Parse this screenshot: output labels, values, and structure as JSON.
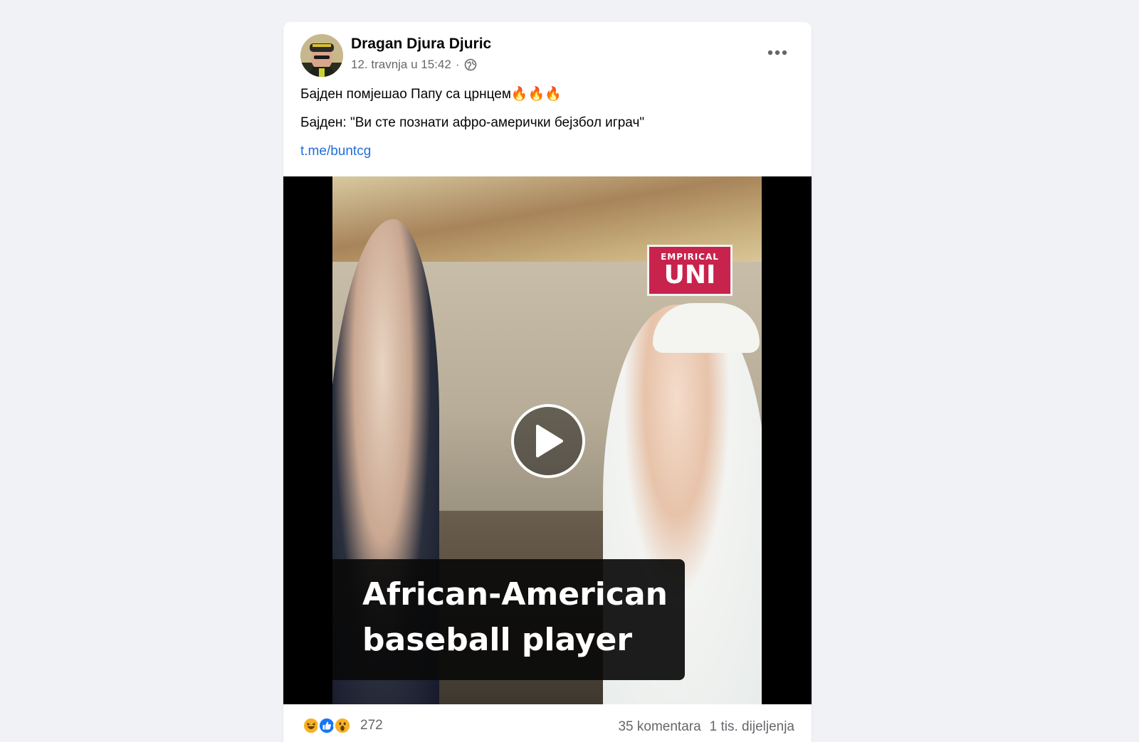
{
  "post": {
    "author": "Dragan Djura Djuric",
    "timestamp": "12. travnja u 15:42",
    "separator": "·",
    "privacy_icon": "globe-icon",
    "more_icon": "more-options-icon",
    "lines": [
      "Бајден помјешао Папу са црнцем🔥🔥🔥",
      "Бајден: \"Ви сте познати афро-амерички бејзбол играч\""
    ],
    "link": "t.me/buntcg"
  },
  "video": {
    "brand_top": "EMPIRICAL",
    "brand_bottom": "UNI",
    "caption_line1": "African-American",
    "caption_line2": "baseball player",
    "play_icon": "play-icon"
  },
  "footer": {
    "reaction_icons": [
      "haha-icon",
      "like-icon",
      "wow-icon"
    ],
    "reaction_count": "272",
    "comments": "35 komentara",
    "shares": "1 tis. dijeljenja"
  },
  "colors": {
    "link": "#216fdb",
    "secondary_text": "#65676b",
    "brand_badge": "#c8234d",
    "like_blue": "#1877f2",
    "reaction_yellow": "#f7b125"
  }
}
